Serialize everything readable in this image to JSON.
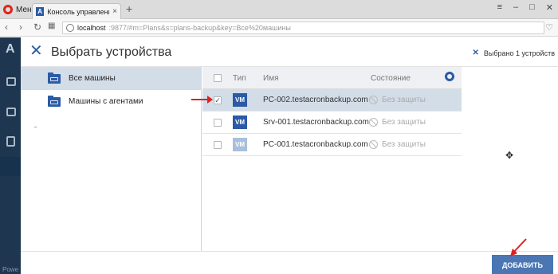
{
  "browser": {
    "menu_label": "Меню",
    "tab_title": "Консоль управления резер",
    "tab_favicon_letter": "A",
    "new_tab_glyph": "+",
    "url_host": "localhost",
    "url_rest": ":9877/#m=Plans&s=plans-backup&key=Все%20машины"
  },
  "rail": {
    "logo_letter": "A",
    "bottom_text": "Powe"
  },
  "dialog": {
    "title": "Выбрать устройства",
    "selected_text": "Выбрано 1 устройств",
    "tree": [
      {
        "label": "Все машины",
        "active": true
      },
      {
        "label": "Машины с агентами",
        "active": false
      }
    ],
    "table": {
      "col_type": "Тип",
      "col_name": "Имя",
      "col_state": "Состояние",
      "rows": [
        {
          "type": "VM",
          "name": "PC-002.testacronbackup.com",
          "state": "Без защиты",
          "checked": true
        },
        {
          "type": "VM",
          "name": "Srv-001.testacronbackup.com",
          "state": "Без защиты",
          "checked": false
        },
        {
          "type": "VM",
          "name": "PC-001.testacronbackup.com",
          "state": "Без защиты",
          "checked": false
        }
      ]
    },
    "add_button": "ДОБАВИТЬ"
  },
  "colors": {
    "accent": "#2b5aa6",
    "rail": "#1e3650",
    "selection": "#d3dde8",
    "annotation_arrow": "#e02020"
  }
}
